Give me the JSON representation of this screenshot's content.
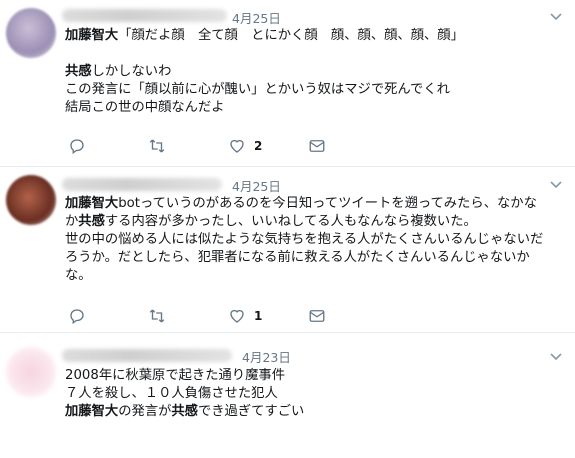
{
  "tweets": [
    {
      "date": "4月25日",
      "avatar_color": "#b0a4c4",
      "lines": [
        [
          {
            "b": "加藤智大"
          },
          {
            "t": "「顔だよ顔　全て顔　とにかく顔　顔、顔、顔、顔、顔」"
          }
        ],
        [],
        [
          {
            "b": "共感"
          },
          {
            "t": "しかしないわ"
          }
        ],
        [
          {
            "t": "この発言に「顔以前に心が醜い」とかいう奴はマジで死んでくれ"
          }
        ],
        [
          {
            "t": "結局この世の中顔なんだよ"
          }
        ]
      ],
      "likes": "2"
    },
    {
      "date": "4月25日",
      "avatar_color": "#8a4a38",
      "lines": [
        [
          {
            "b": "加藤智大"
          },
          {
            "t": "botっていうのがあるのを今日知ってツイートを遡ってみたら、なかな"
          }
        ],
        [
          {
            "t": "か"
          },
          {
            "b": "共感"
          },
          {
            "t": "する内容が多かったし、いいねしてる人もなんなら複数いた。"
          }
        ],
        [
          {
            "t": "世の中の悩める人には似たような気持ちを抱える人がたくさんいるんじゃないだ"
          }
        ],
        [
          {
            "t": "ろうか。だとしたら、犯罪者になる前に救える人がたくさんいるんじゃないか"
          }
        ],
        [
          {
            "t": "な。"
          }
        ]
      ],
      "likes": "1"
    },
    {
      "date": "4月23日",
      "avatar_color": "#f4c8d6",
      "lines": [
        [
          {
            "t": "2008年に秋葉原で起きた通り魔事件"
          }
        ],
        [
          {
            "t": "７人を殺し、１０人負傷させた犯人"
          }
        ],
        [
          {
            "b": "加藤智大"
          },
          {
            "t": "の発言が"
          },
          {
            "b": "共感"
          },
          {
            "t": "でき過ぎてすごい"
          }
        ]
      ],
      "likes": ""
    }
  ]
}
